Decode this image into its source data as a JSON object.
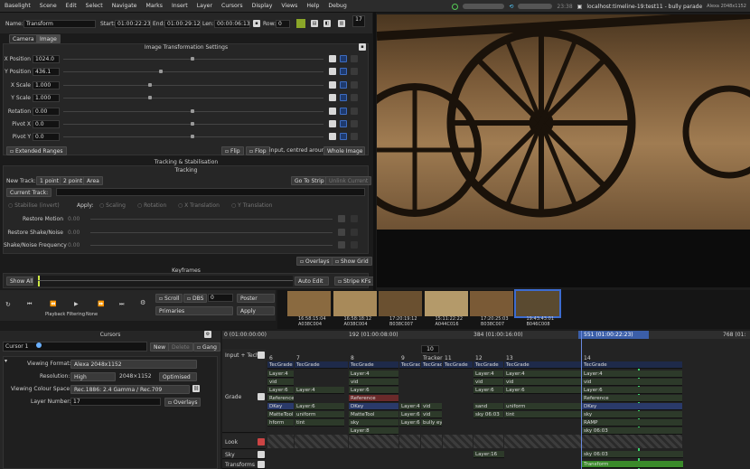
{
  "menubar": {
    "items": [
      "Baselight",
      "Scene",
      "Edit",
      "Select",
      "Navigate",
      "Marks",
      "Insert",
      "Layer",
      "Cursors",
      "Display",
      "Views",
      "Help",
      "Debug"
    ],
    "time": "23:38",
    "host": "localhost:timeline-19:test11 - bully parade",
    "format": "Alexa 2048x1152"
  },
  "top": {
    "name_label": "Name:",
    "name_value": "Transform",
    "start_label": "Start:",
    "start_value": "01:00:22:23",
    "end_label": "End:",
    "end_value": "01:00:29:12",
    "len_label": "Len:",
    "len_value": "00:00:06:13",
    "row_label": "Row:",
    "row_value": "0",
    "counter": "17"
  },
  "tabs": [
    "Camera",
    "Image"
  ],
  "transform": {
    "title": "Image Transformation Settings",
    "params": [
      {
        "label": "X Position",
        "value": "1024.0"
      },
      {
        "label": "Y Position",
        "value": "436.1"
      },
      {
        "label": "X Scale",
        "value": "1.000"
      },
      {
        "label": "Y Scale",
        "value": "1.000"
      },
      {
        "label": "Rotation",
        "value": "0.00"
      },
      {
        "label": "Pivot X",
        "value": "0.0"
      },
      {
        "label": "Pivot Y",
        "value": "0.0"
      }
    ],
    "extended": "Extended Ranges",
    "flip": "Flip",
    "flop": "Flop",
    "input_label": "input, centred around",
    "whole_image": "Whole Image"
  },
  "tracking": {
    "title": "Tracking & Stabilisation",
    "subtitle": "Tracking",
    "new_track": "New Track:",
    "one_point": "1 point",
    "two_point": "2 point",
    "area": "Area",
    "goto": "Go To Strip",
    "unlink": "Unlink Current",
    "current_track": "Current Track:",
    "stabilise": "Stabilise (invert)",
    "apply": "Apply:",
    "scaling": "Scaling",
    "rotation": "Rotation",
    "x_translation": "X Translation",
    "y_translation": "Y Translation",
    "rows": [
      {
        "label": "Restore Motion",
        "value": "0.00"
      },
      {
        "label": "Restore Shake/Noise",
        "value": "0.00"
      },
      {
        "label": "Shake/Noise Frequency",
        "value": "0.00"
      }
    ],
    "overlays": "Overlays",
    "show_grid": "Show Grid"
  },
  "keyframes": {
    "title": "Keyframes",
    "show": "Show All",
    "auto_edit": "Auto Edit",
    "stripe": "Stripe KFs"
  },
  "transport": {
    "scroll": "Scroll",
    "dbs": "DBS",
    "dbs_value": "0",
    "poster": "Poster",
    "primaries": "Primaries",
    "apply": "Apply",
    "playback_label": "Playback Filtering",
    "playback_value": "None"
  },
  "thumbs": [
    {
      "tc": "16:58:15:04",
      "name": "A038C004"
    },
    {
      "tc": "16:58:18:12",
      "name": "A038C004"
    },
    {
      "tc": "17:20:19:12",
      "name": "B038C007"
    },
    {
      "tc": "15:11:22:22",
      "name": "A044C016"
    },
    {
      "tc": "17:20:25:03",
      "name": "B038C007"
    },
    {
      "tc": "19:43:43:01",
      "name": "B046C008"
    }
  ],
  "cursors": {
    "title": "Cursors",
    "cursor": "Cursor 1",
    "new": "New",
    "delete": "Delete",
    "gang": "Gang",
    "viewing_format_label": "Viewing Format:",
    "viewing_format": "Alexa 2048x1152",
    "resolution_label": "Resolution:",
    "resolution": "High",
    "resolution_size": "2048×1152",
    "optimised": "Optimised",
    "colour_label": "Viewing Colour Space:",
    "colour": "Rec.1886: 2.4 Gamma / Rec.709",
    "layer_label": "Layer Number:",
    "layer": "17",
    "overlays": "Overlays"
  },
  "timeline": {
    "ruler": [
      "0 (01:00:00:00)",
      "192 (01:00:08:00)",
      "384 (01:00:16:00)",
      "551 (01:00:22:23)",
      "768 (01:"
    ],
    "ruler_sub": "10",
    "tracks": [
      "Input + Tech",
      "Grade",
      "Look",
      "Sky",
      "Transforms"
    ],
    "shots": [
      {
        "n": "6",
        "tech": "TecGrade"
      },
      {
        "n": "7",
        "tech": "TecGrade"
      },
      {
        "n": "8",
        "tech": "TecGrade"
      },
      {
        "n": "9",
        "tech": "TecGrade"
      },
      {
        "n": "Tracker",
        "tech": "TecGrade"
      },
      {
        "n": "11",
        "tech": "TecGrade"
      },
      {
        "n": "12",
        "tech": "TecGrade"
      },
      {
        "n": "13",
        "tech": "TecGrade"
      },
      {
        "n": "14",
        "tech": "TecGrade"
      }
    ],
    "col1": [
      "Layer:4",
      "vid",
      "Layer:6",
      "Reference",
      "DKey",
      "MatteTool",
      "hform"
    ],
    "col2": [
      "",
      "",
      "Layer:4",
      "",
      "Layer:6",
      "uniform",
      "tint"
    ],
    "col3": [
      "Layer:4",
      "vid",
      "Layer:6",
      "Reference",
      "DKey",
      "MatteTool",
      "sky",
      "Layer:8"
    ],
    "col4": [
      "",
      "",
      "",
      "",
      "Layer:4",
      "Layer:6",
      "Layer:6"
    ],
    "col5": [
      "",
      "",
      "",
      "",
      "vid",
      "vid",
      "bully eyle"
    ],
    "col6": [
      "Layer:4",
      "vid",
      "Layer:6",
      "",
      "sand",
      "sky 06:03"
    ],
    "col7": [
      "Layer:4",
      "vid",
      "Layer:6",
      "",
      "uniform",
      "tint"
    ],
    "col8": [
      "Layer:4",
      "vid",
      "Layer:6",
      "Reference",
      "DKey",
      "sky",
      "RAMP",
      "sky 06:03"
    ],
    "sky_clip": "sky 06:03",
    "layer16": "Layer:16",
    "transform_clip": "Transform"
  }
}
